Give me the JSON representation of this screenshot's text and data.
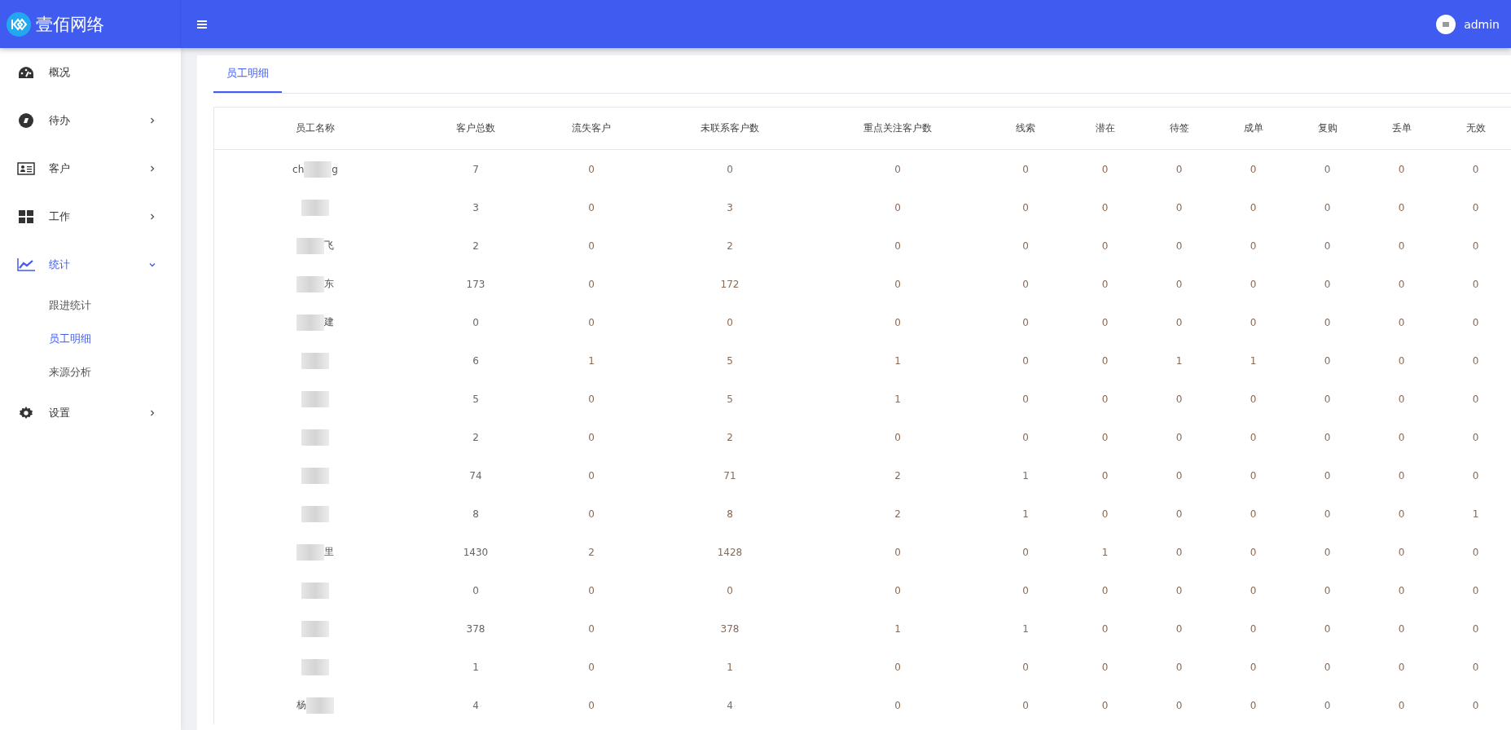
{
  "brand": {
    "name": "壹佰网络"
  },
  "user": {
    "name": "admin"
  },
  "menu": [
    {
      "kind": "dashboard",
      "label": "概况",
      "has_children": false,
      "selected": false
    },
    {
      "kind": "todo",
      "label": "待办",
      "has_children": true,
      "expanded": false,
      "selected": false
    },
    {
      "kind": "customer",
      "label": "客户",
      "has_children": true,
      "expanded": false,
      "selected": false
    },
    {
      "kind": "work",
      "label": "工作",
      "has_children": true,
      "expanded": false,
      "selected": false
    },
    {
      "kind": "stats",
      "label": "统计",
      "has_children": true,
      "expanded": true,
      "selected": true,
      "children": [
        {
          "label": "跟进统计",
          "selected": false
        },
        {
          "label": "员工明细",
          "selected": true
        },
        {
          "label": "来源分析",
          "selected": false
        }
      ]
    },
    {
      "kind": "settings",
      "label": "设置",
      "has_children": true,
      "expanded": false,
      "selected": false
    }
  ],
  "tabs": [
    {
      "label": "员工明细",
      "selected": true
    }
  ],
  "table": {
    "columns": [
      "员工名称",
      "客户总数",
      "流失客户",
      "未联系客户数",
      "重点关注客户数",
      "线索",
      "潜在",
      "待签",
      "成单",
      "复购",
      "丢单",
      "无效"
    ],
    "rows": [
      {
        "cells": [
          {
            "head": "ch",
            "tail": "g",
            "redacted": true
          },
          "7",
          "0",
          "0",
          "0",
          "0",
          "0",
          "0",
          "0",
          "0",
          "0",
          "0"
        ]
      },
      {
        "cells": [
          {
            "redacted": true
          },
          "3",
          "0",
          "3",
          "0",
          "0",
          "0",
          "0",
          "0",
          "0",
          "0",
          "0"
        ]
      },
      {
        "cells": [
          {
            "tail": "飞",
            "redacted": true
          },
          "2",
          "0",
          "2",
          "0",
          "0",
          "0",
          "0",
          "0",
          "0",
          "0",
          "0"
        ]
      },
      {
        "cells": [
          {
            "tail": "东",
            "redacted": true
          },
          "173",
          "0",
          "172",
          "0",
          "0",
          "0",
          "0",
          "0",
          "0",
          "0",
          "0"
        ]
      },
      {
        "cells": [
          {
            "tail": "建",
            "redacted": true
          },
          "0",
          "0",
          "0",
          "0",
          "0",
          "0",
          "0",
          "0",
          "0",
          "0",
          "0"
        ]
      },
      {
        "cells": [
          {
            "redacted": true
          },
          "6",
          "1",
          "5",
          "1",
          "0",
          "0",
          "1",
          "1",
          "0",
          "0",
          "0"
        ]
      },
      {
        "cells": [
          {
            "redacted": true
          },
          "5",
          "0",
          "5",
          "1",
          "0",
          "0",
          "0",
          "0",
          "0",
          "0",
          "0"
        ]
      },
      {
        "cells": [
          {
            "redacted": true
          },
          "2",
          "0",
          "2",
          "0",
          "0",
          "0",
          "0",
          "0",
          "0",
          "0",
          "0"
        ]
      },
      {
        "cells": [
          {
            "redacted": true
          },
          "74",
          "0",
          "71",
          "2",
          "1",
          "0",
          "0",
          "0",
          "0",
          "0",
          "0"
        ]
      },
      {
        "cells": [
          {
            "redacted": true
          },
          "8",
          "0",
          "8",
          "2",
          "1",
          "0",
          "0",
          "0",
          "0",
          "0",
          "1"
        ]
      },
      {
        "cells": [
          {
            "tail": "里",
            "redacted": true
          },
          "1430",
          "2",
          "1428",
          "0",
          "0",
          "1",
          "0",
          "0",
          "0",
          "0",
          "0"
        ]
      },
      {
        "cells": [
          {
            "redacted": true
          },
          "0",
          "0",
          "0",
          "0",
          "0",
          "0",
          "0",
          "0",
          "0",
          "0",
          "0"
        ]
      },
      {
        "cells": [
          {
            "redacted": true
          },
          "378",
          "0",
          "378",
          "1",
          "1",
          "0",
          "0",
          "0",
          "0",
          "0",
          "0"
        ]
      },
      {
        "cells": [
          {
            "redacted": true
          },
          "1",
          "0",
          "1",
          "0",
          "0",
          "0",
          "0",
          "0",
          "0",
          "0",
          "0"
        ]
      },
      {
        "cells": [
          {
            "head": "杨",
            "redacted": true
          },
          "4",
          "0",
          "4",
          "0",
          "0",
          "0",
          "0",
          "0",
          "0",
          "0",
          "0"
        ]
      }
    ]
  }
}
